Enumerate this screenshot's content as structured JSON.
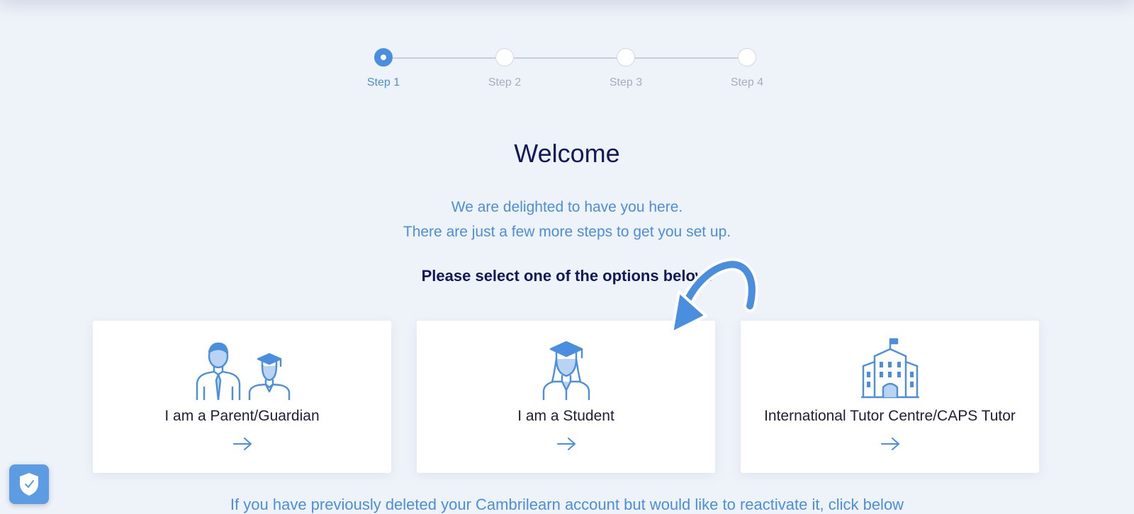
{
  "stepper": {
    "steps": [
      {
        "label": "Step 1",
        "active": true
      },
      {
        "label": "Step 2",
        "active": false
      },
      {
        "label": "Step 3",
        "active": false
      },
      {
        "label": "Step 4",
        "active": false
      }
    ]
  },
  "welcome": {
    "title": "Welcome",
    "line1": "We are delighted to have you here.",
    "line2": "There are just a few more steps to get you set up.",
    "instruction": "Please select one of the options below:"
  },
  "options": [
    {
      "label": "I am a Parent/Guardian",
      "icon": "parent-student-icon"
    },
    {
      "label": "I am a Student",
      "icon": "student-icon"
    },
    {
      "label": "International Tutor Centre/CAPS Tutor",
      "icon": "school-building-icon"
    }
  ],
  "footer": {
    "reactivate_text": "If you have previously deleted your Cambrilearn account but would like to reactivate it, click below"
  },
  "colors": {
    "accent": "#4a8fdf",
    "heading": "#13185a",
    "background": "#eef2f9",
    "card": "#ffffff"
  }
}
